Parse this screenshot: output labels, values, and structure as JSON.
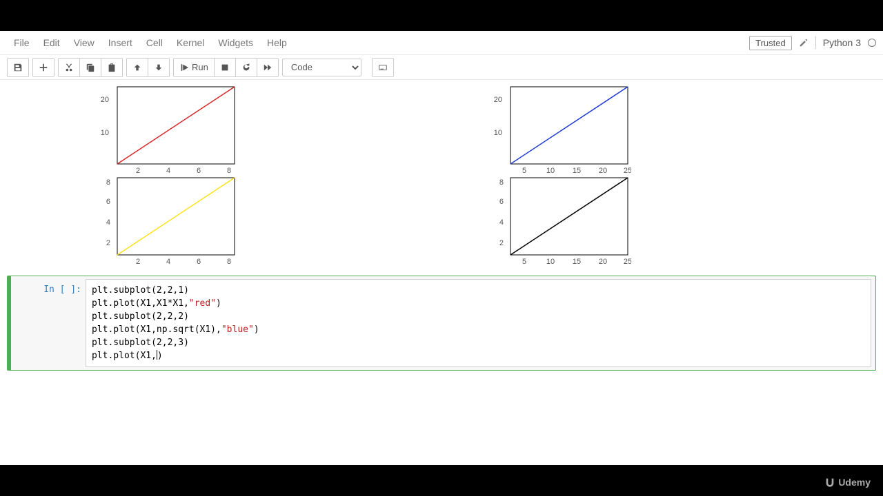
{
  "menu": {
    "file": "File",
    "edit": "Edit",
    "view": "View",
    "insert": "Insert",
    "cell": "Cell",
    "kernel": "Kernel",
    "widgets": "Widgets",
    "help": "Help"
  },
  "header_right": {
    "trusted": "Trusted",
    "kernel": "Python 3"
  },
  "toolbar": {
    "run": "Run",
    "celltype": "Code"
  },
  "code_cell": {
    "prompt": "In [ ]:",
    "line1a": "plt.subplot(",
    "line1b": "2,2,1",
    "line1c": ")",
    "line2a": "plt.plot(X1,X1*X1,",
    "line2b": "\"red\"",
    "line2c": ")",
    "line3a": "plt.subplot(",
    "line3b": "2,2,2",
    "line3c": ")",
    "line4a": "plt.plot(X1,np.sqrt(X1),",
    "line4b": "\"blue\"",
    "line4c": ")",
    "line5a": "plt.subplot(",
    "line5b": "2,2,3",
    "line5c": ")",
    "line6a": "plt.plot(X1,",
    "line6b": ")"
  },
  "brand": "Udemy",
  "chart_data": [
    {
      "type": "line",
      "series": [
        {
          "name": "red",
          "color": "#d62728",
          "x": [
            1,
            8
          ],
          "y": [
            3,
            25
          ]
        }
      ],
      "xticks": [
        2,
        4,
        6,
        8
      ],
      "yticks": [
        10,
        20
      ],
      "xlim": [
        1,
        8.5
      ],
      "ylim": [
        3,
        25
      ]
    },
    {
      "type": "line",
      "series": [
        {
          "name": "blue",
          "color": "#1f3bd6",
          "x": [
            2.5,
            25
          ],
          "y": [
            3,
            25
          ]
        }
      ],
      "xticks": [
        5,
        10,
        15,
        20,
        25
      ],
      "yticks": [
        10,
        20
      ],
      "xlim": [
        2.5,
        25.5
      ],
      "ylim": [
        3,
        25
      ]
    },
    {
      "type": "line",
      "series": [
        {
          "name": "yellow",
          "color": "#ffe119",
          "x": [
            1,
            8
          ],
          "y": [
            1,
            8
          ]
        }
      ],
      "xticks": [
        2,
        4,
        6,
        8
      ],
      "yticks": [
        2,
        4,
        6,
        8
      ],
      "xlim": [
        1,
        8.5
      ],
      "ylim": [
        1,
        8.5
      ]
    },
    {
      "type": "line",
      "series": [
        {
          "name": "black",
          "color": "#000000",
          "x": [
            2.5,
            25
          ],
          "y": [
            1,
            8
          ]
        }
      ],
      "xticks": [
        5,
        10,
        15,
        20,
        25
      ],
      "yticks": [
        2,
        4,
        6,
        8
      ],
      "xlim": [
        2.5,
        25.5
      ],
      "ylim": [
        1,
        8.5
      ]
    }
  ]
}
